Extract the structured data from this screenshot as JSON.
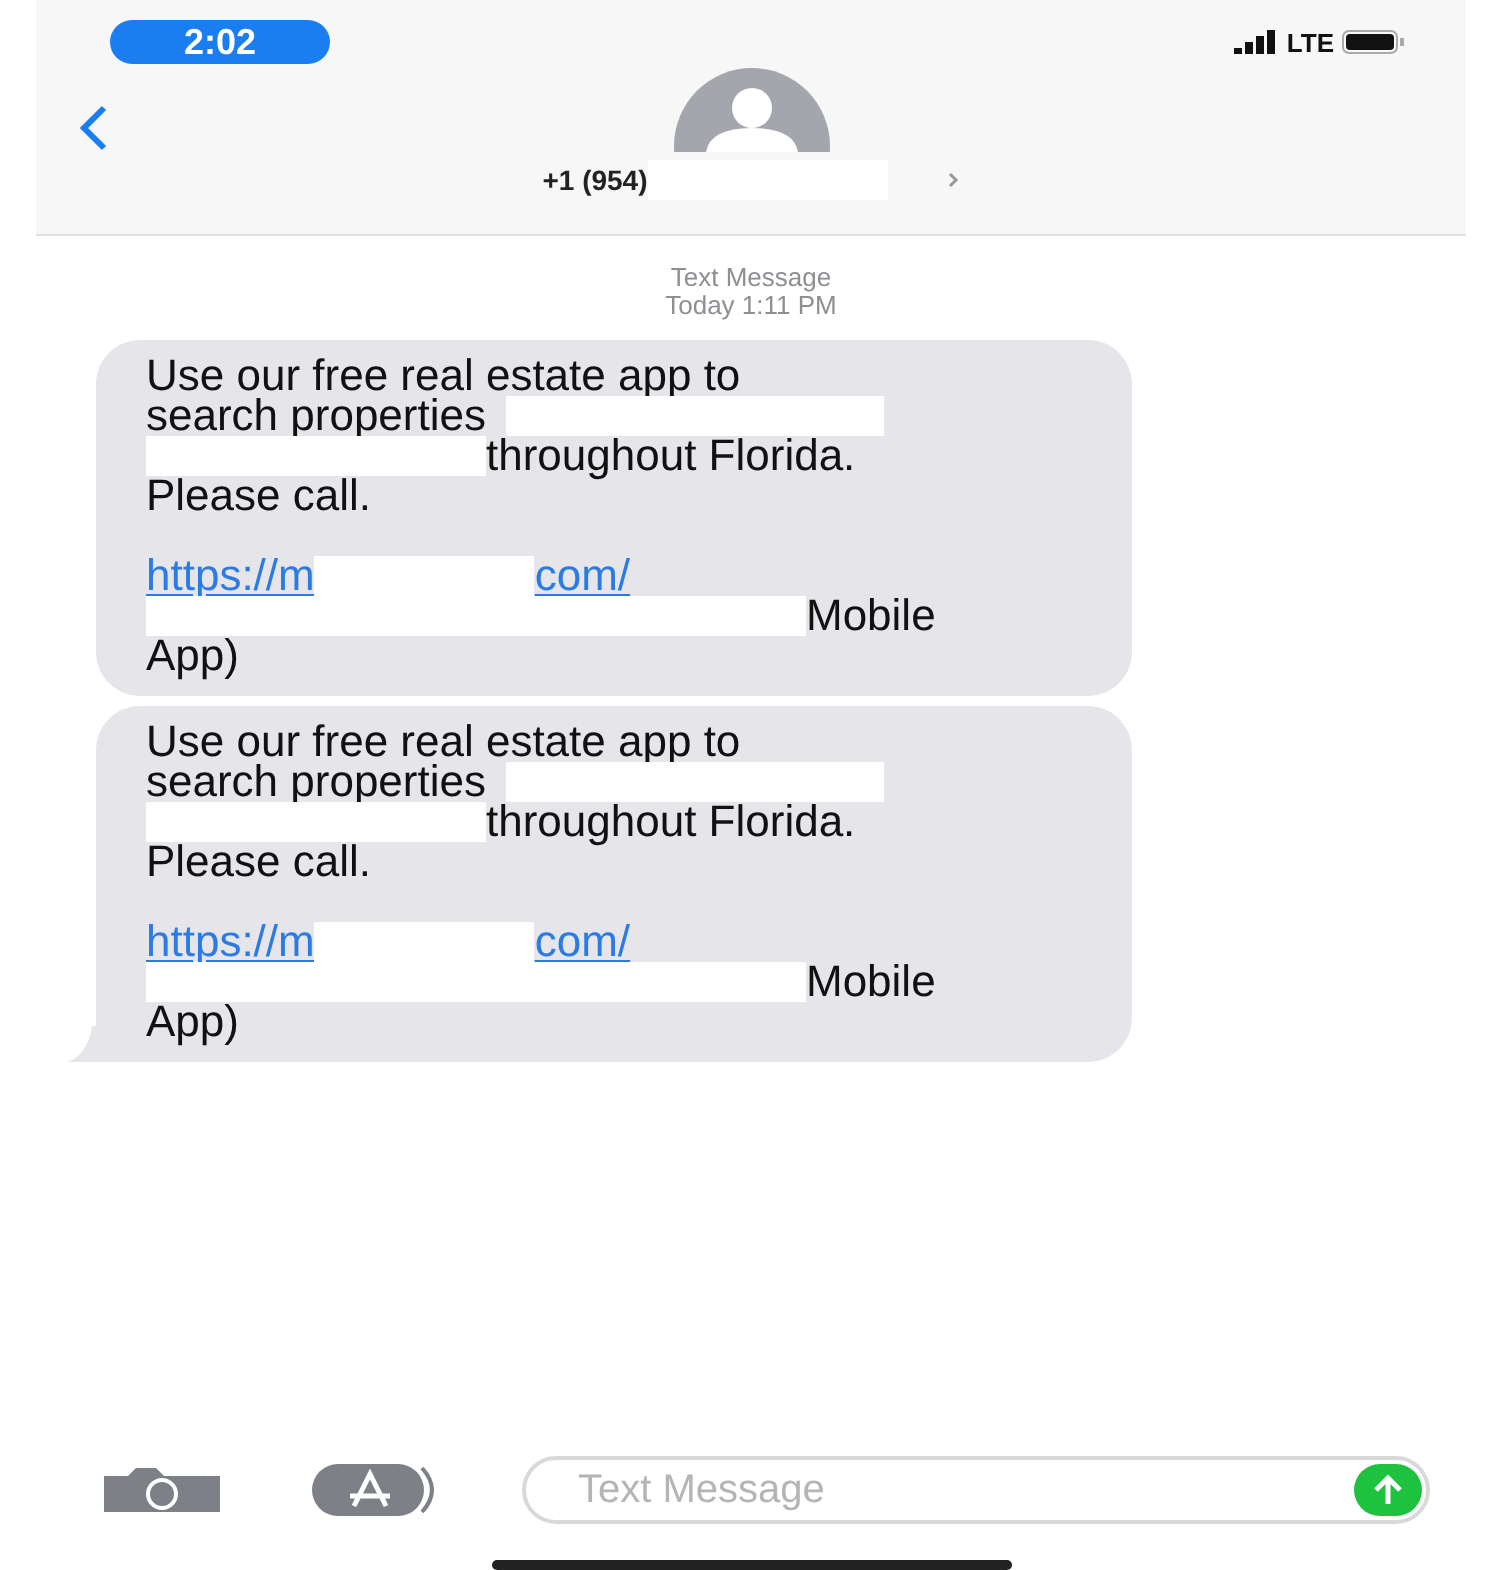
{
  "status_bar": {
    "time": "2:02",
    "network": "LTE"
  },
  "header": {
    "contact": [
      {
        "kind": "text",
        "text": "+1 (954)"
      },
      {
        "kind": "redaction"
      }
    ]
  },
  "timestamp": {
    "label": "Text Message",
    "time": "Today 1:11 PM"
  },
  "messages": [
    {
      "tail": false,
      "paragraphs": [
        [
          [
            {
              "kind": "text",
              "text": "Use our free real estate app to"
            }
          ],
          [
            {
              "kind": "text",
              "text": "search properties"
            },
            {
              "kind": "redaction"
            }
          ],
          [
            {
              "kind": "redaction"
            },
            {
              "kind": "text",
              "text": "throughout Florida."
            }
          ],
          [
            {
              "kind": "text",
              "text": "Please call."
            }
          ]
        ],
        [
          [
            {
              "kind": "link",
              "text": "https://m"
            },
            {
              "kind": "redaction"
            },
            {
              "kind": "link",
              "text": "com/"
            }
          ],
          [
            {
              "kind": "redaction"
            },
            {
              "kind": "text",
              "text": "Mobile"
            }
          ],
          [
            {
              "kind": "text",
              "text": "App)"
            }
          ]
        ]
      ]
    },
    {
      "tail": true,
      "paragraphs": [
        [
          [
            {
              "kind": "text",
              "text": "Use our free real estate app to"
            }
          ],
          [
            {
              "kind": "text",
              "text": "search properties"
            },
            {
              "kind": "redaction"
            }
          ],
          [
            {
              "kind": "redaction"
            },
            {
              "kind": "text",
              "text": "throughout Florida."
            }
          ],
          [
            {
              "kind": "text",
              "text": "Please call."
            }
          ]
        ],
        [
          [
            {
              "kind": "link",
              "text": "https://m"
            },
            {
              "kind": "redaction"
            },
            {
              "kind": "link",
              "text": "com/"
            }
          ],
          [
            {
              "kind": "redaction"
            },
            {
              "kind": "text",
              "text": "Mobile"
            }
          ],
          [
            {
              "kind": "text",
              "text": "App)"
            }
          ]
        ]
      ]
    }
  ],
  "composer": {
    "placeholder": "Text Message"
  }
}
